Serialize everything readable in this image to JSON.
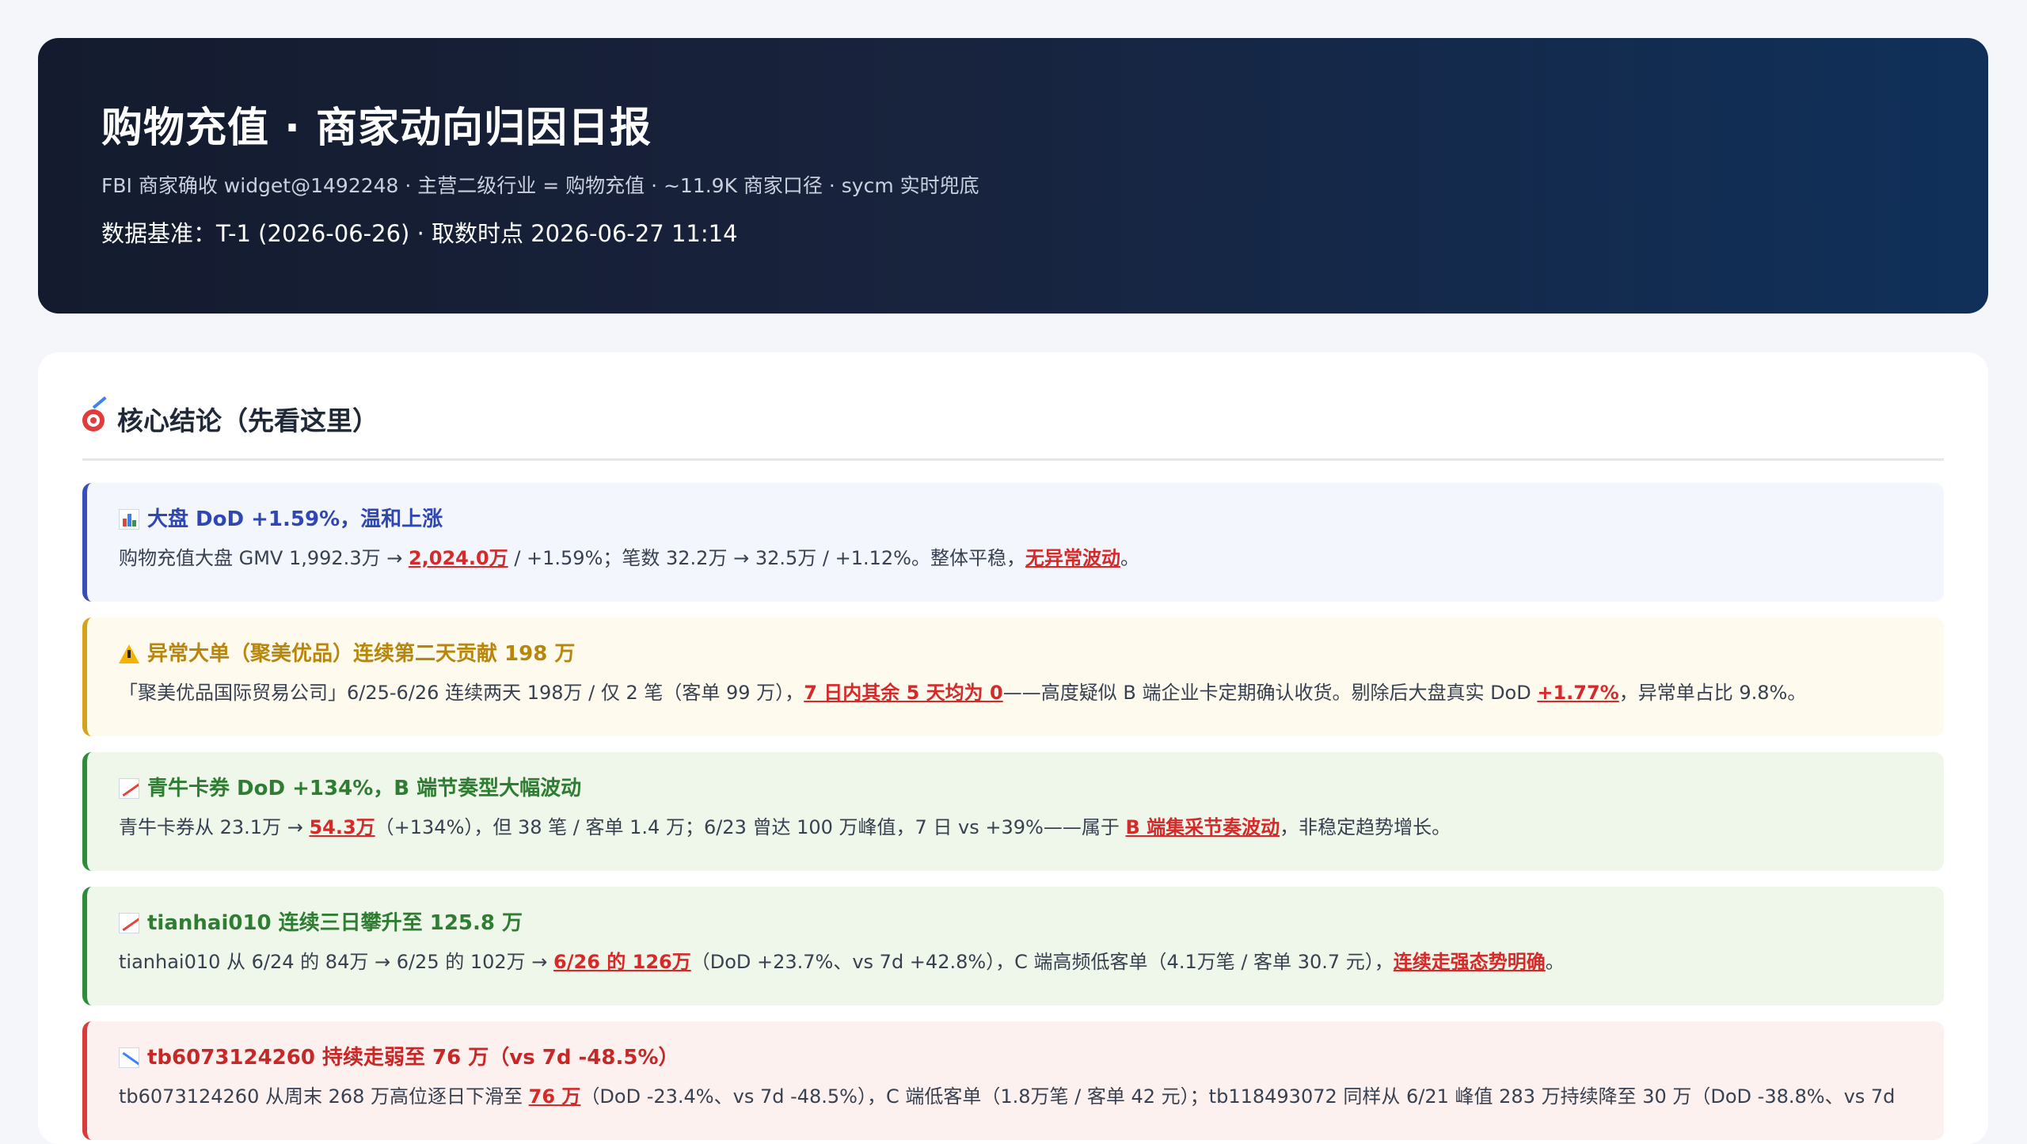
{
  "header": {
    "title": "购物充值 · 商家动向归因日报",
    "subtitle": "FBI 商家确收 widget@1492248 · 主营二级行业 = 购物充值 · ~11.9K 商家口径 · sycm 实时兜底",
    "baseline": "数据基准：T-1 (2026-06-26) · 取数时点 2026-06-27 11:14"
  },
  "core": {
    "icon": "target-icon",
    "title": "核心结论（先看这里）"
  },
  "items": [
    {
      "tone": "blue",
      "icon": "bar-chart-icon",
      "title": "大盘 DoD +1.59%，温和上涨",
      "body": [
        {
          "t": "购物充值大盘 GMV 1,992.3万 → "
        },
        {
          "t": "2,024.0万",
          "hl": true
        },
        {
          "t": " / +1.59%；笔数 32.2万 → 32.5万 / +1.12%。整体平稳，"
        },
        {
          "t": "无异常波动",
          "hl": true
        },
        {
          "t": "。"
        }
      ]
    },
    {
      "tone": "yellow",
      "icon": "warning-icon",
      "title": "异常大单（聚美优品）连续第二天贡献 198 万",
      "body": [
        {
          "t": "「聚美优品国际贸易公司」6/25-6/26 连续两天 198万 / 仅 2 笔（客单 99 万），"
        },
        {
          "t": "7 日内其余 5 天均为 0",
          "hl": true
        },
        {
          "t": "——高度疑似 B 端企业卡定期确认收货。剔除后大盘真实 DoD "
        },
        {
          "t": "+1.77%",
          "hl": true
        },
        {
          "t": "，异常单占比 9.8%。"
        }
      ]
    },
    {
      "tone": "green",
      "icon": "trend-up-icon",
      "title": "青牛卡券 DoD +134%，B 端节奏型大幅波动",
      "body": [
        {
          "t": "青牛卡券从 23.1万 → "
        },
        {
          "t": "54.3万",
          "hl": true
        },
        {
          "t": "（+134%），但 38 笔 / 客单 1.4 万；6/23 曾达 100 万峰值，7 日 vs +39%——属于 "
        },
        {
          "t": "B 端集采节奏波动",
          "hl": true
        },
        {
          "t": "，非稳定趋势增长。"
        }
      ]
    },
    {
      "tone": "green",
      "icon": "trend-up-icon",
      "title": "tianhai010 连续三日攀升至 125.8 万",
      "body": [
        {
          "t": "tianhai010 从 6/24 的 84万 → 6/25 的 102万 → "
        },
        {
          "t": "6/26 的 126万",
          "hl": true
        },
        {
          "t": "（DoD +23.7%、vs 7d +42.8%），C 端高频低客单（4.1万笔 / 客单 30.7 元），"
        },
        {
          "t": "连续走强态势明确",
          "hl": true
        },
        {
          "t": "。"
        }
      ]
    },
    {
      "tone": "red",
      "icon": "trend-down-icon",
      "title": "tb6073124260 持续走弱至 76 万（vs 7d -48.5%）",
      "body": [
        {
          "t": "tb6073124260 从周末 268 万高位逐日下滑至 "
        },
        {
          "t": "76 万",
          "hl": true
        },
        {
          "t": "（DoD -23.4%、vs 7d -48.5%），C 端低客单（1.8万笔 / 客单 42 元）；tb118493072 同样从 6/21 峰值 283 万持续降至 30 万（DoD -38.8%、vs 7d"
        }
      ]
    }
  ]
}
